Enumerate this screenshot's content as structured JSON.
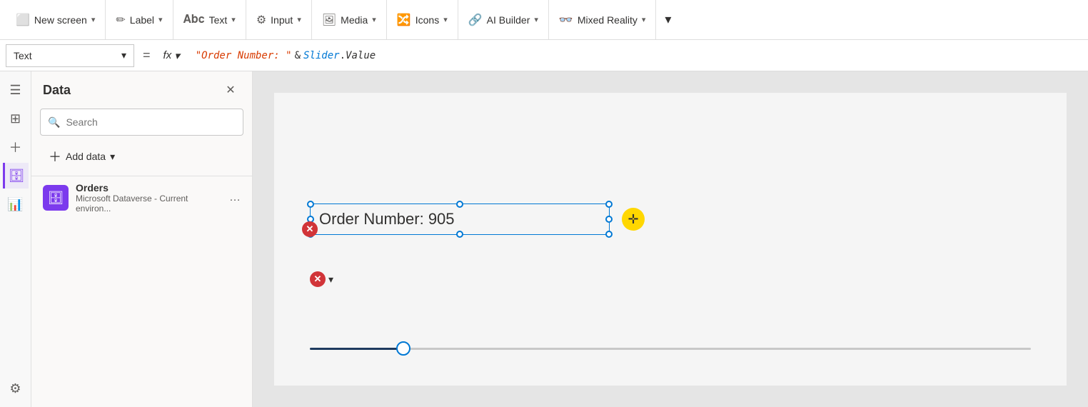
{
  "toolbar": {
    "new_screen_label": "New screen",
    "label_label": "Label",
    "text_label": "Text",
    "input_label": "Input",
    "media_label": "Media",
    "icons_label": "Icons",
    "ai_builder_label": "AI Builder",
    "mixed_reality_label": "Mixed Reality"
  },
  "formula_bar": {
    "property": "Text",
    "equals": "=",
    "fx": "fx",
    "formula": "\"Order Number: \" & Slider.Value"
  },
  "data_panel": {
    "title": "Data",
    "search_placeholder": "Search",
    "add_data_label": "Add data",
    "data_sources": [
      {
        "name": "Orders",
        "subtitle": "Microsoft Dataverse - Current environ..."
      }
    ]
  },
  "canvas": {
    "text_element": "Order Number: 905",
    "slider_value": 905
  },
  "icons": {
    "hamburger": "☰",
    "layers": "⊞",
    "add": "+",
    "database": "⊚",
    "chart": "📊",
    "settings": "⚙"
  }
}
